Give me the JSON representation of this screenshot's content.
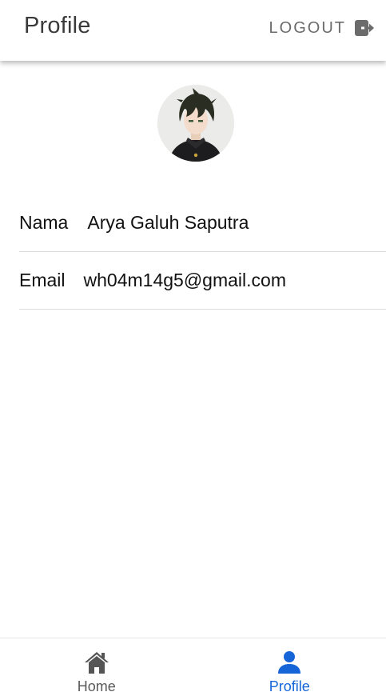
{
  "header": {
    "title": "Profile",
    "logout_label": "LOGOUT",
    "logout_icon": "logout-icon"
  },
  "profile": {
    "avatar_icon": "avatar-image",
    "fields": [
      {
        "key": "Nama",
        "value": "Arya Galuh Saputra"
      },
      {
        "key": "Email",
        "value": "wh04m14g5@gmail.com"
      }
    ]
  },
  "bottom_nav": {
    "items": [
      {
        "label": "Home",
        "icon": "home-icon",
        "active": false
      },
      {
        "label": "Profile",
        "icon": "person-icon",
        "active": true
      }
    ]
  },
  "colors": {
    "accent": "#1565d8",
    "inactive": "#5a5a5a",
    "divider": "#dcdcdc"
  }
}
